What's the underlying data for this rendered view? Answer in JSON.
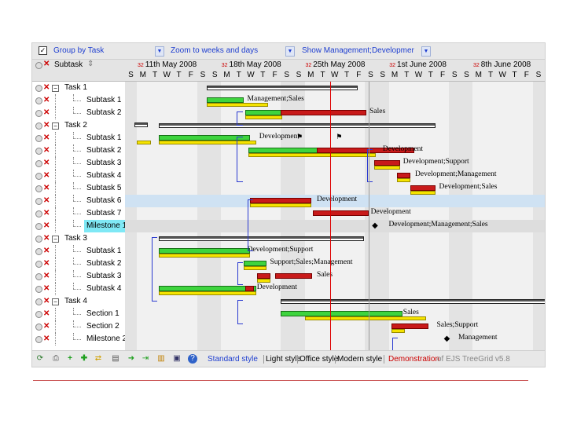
{
  "toolbar": {
    "group_by": "Group by Task",
    "zoom": "Zoom to weeks and days",
    "show": "Show Management;Developmer"
  },
  "header": {
    "subtask_label": "Subtask",
    "weeks": [
      "11th May 2008",
      "18th May 2008",
      "25th May 2008",
      "1st June 2008",
      "8th June 2008"
    ],
    "days": [
      "S",
      "M",
      "T",
      "W",
      "T",
      "F",
      "S",
      "S",
      "M",
      "T",
      "W",
      "T",
      "F",
      "S",
      "S",
      "M",
      "T",
      "W",
      "T",
      "F",
      "S",
      "S",
      "M",
      "T",
      "W",
      "T",
      "F",
      "S",
      "S",
      "M",
      "T",
      "W",
      "T",
      "F",
      "S"
    ]
  },
  "rows": [
    {
      "label": "Task 1",
      "level": 0
    },
    {
      "label": "Subtask 1",
      "level": 1
    },
    {
      "label": "Subtask 2",
      "level": 1
    },
    {
      "label": "Task 2",
      "level": 0
    },
    {
      "label": "Subtask 1",
      "level": 1
    },
    {
      "label": "Subtask 2",
      "level": 1
    },
    {
      "label": "Subtask 3",
      "level": 1
    },
    {
      "label": "Subtask 4",
      "level": 1
    },
    {
      "label": "Subtask 5",
      "level": 1
    },
    {
      "label": "Subtask 6",
      "level": 1
    },
    {
      "label": "Subtask 7",
      "level": 1
    },
    {
      "label": "Milestone 1",
      "level": 1
    },
    {
      "label": "Task 3",
      "level": 0
    },
    {
      "label": "Subtask 1",
      "level": 1
    },
    {
      "label": "Subtask 2",
      "level": 1
    },
    {
      "label": "Subtask 3",
      "level": 1
    },
    {
      "label": "Subtask 4",
      "level": 1
    },
    {
      "label": "Task 4",
      "level": 0
    },
    {
      "label": "Section 1",
      "level": 1
    },
    {
      "label": "Section 2",
      "level": 1
    },
    {
      "label": "Milestone 2",
      "level": 1
    }
  ],
  "notes": [
    "Management;Sales",
    "Sales",
    "Development",
    "Development",
    "Development;Support",
    "Development;Management",
    "Development;Sales",
    "Development",
    "Development",
    "Development;Management;Sales",
    "Development;Support",
    "Support;Sales;Management",
    "Sales",
    "Development",
    "Sales",
    "Sales;Support",
    "Management"
  ],
  "bottom": {
    "styles": [
      "Standard style",
      "Light style",
      "Office style",
      "Modern style"
    ],
    "demo_label": "Demonstration",
    "demo_suffix": "of EJS TreeGrid v5.8"
  },
  "colors": {
    "accent": "#1f3fd0",
    "progress": "#3ed43e",
    "remaining": "#c81a1a",
    "baseline": "#f5e300",
    "today": "#dd0000"
  }
}
